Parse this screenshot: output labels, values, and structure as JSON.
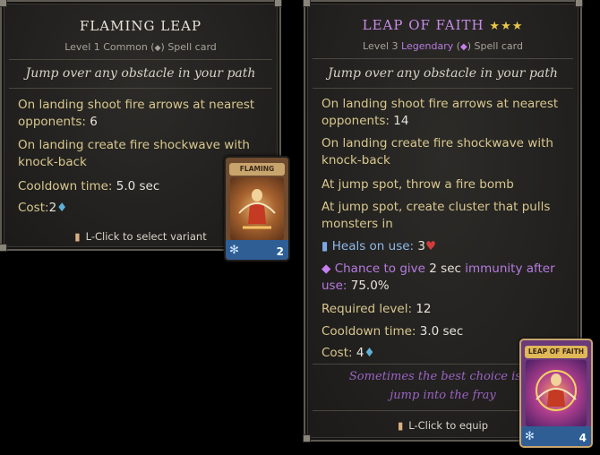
{
  "left_tooltip": {
    "title": "FLAMING LEAP",
    "level_text": "Level 1",
    "rarity": "Common",
    "rarity_icon": "gem-outline-icon",
    "card_type": "Spell card",
    "flavor": "Jump over any obstacle in your path",
    "lines": [
      {
        "label": "On landing shoot fire arrows at nearest opponents:",
        "value": "6"
      },
      {
        "label": "On landing create fire shockwave with knock-back",
        "value": ""
      },
      {
        "label": "Cooldown time:",
        "value": "5.0 sec"
      },
      {
        "label": "Cost:",
        "value": "2"
      }
    ],
    "footer": "L-Click to select variant",
    "card": {
      "banner": "FLAMING LEAP",
      "cost": "2"
    }
  },
  "right_tooltip": {
    "title": "LEAP OF FAITH",
    "stars": "★★★",
    "level_text": "Level 3",
    "rarity": "Legendary",
    "rarity_icon": "purple-gem-icon",
    "card_type": "Spell card",
    "flavor": "Jump over any obstacle in your path",
    "line1_label": "On landing shoot fire arrows at nearest opponents:",
    "line1_value": "14",
    "line2_label": "On landing create fire shockwave with knock-back",
    "line3_label": "At jump spot, throw a fire bomb",
    "line4_label": "At jump spot, create cluster that pulls monsters in",
    "heals_label": "Heals on use:",
    "heals_value": "3",
    "chance_label": "Chance to give",
    "chance_duration": "2 sec",
    "chance_effect": "immunity after use:",
    "chance_value": "75.0%",
    "required_label": "Required level:",
    "required_value": "12",
    "cooldown_label": "Cooldown time:",
    "cooldown_value": "3.0 sec",
    "cost_label": "Cost:",
    "cost_value": "4",
    "lore_line1": "Sometimes the best choice is to",
    "lore_line2": "jump into the fray",
    "footer": "L-Click to equip",
    "card": {
      "banner": "LEAP OF FAITH",
      "cost": "4"
    }
  },
  "colors": {
    "label_gold": "#d9c78e",
    "legendary_purple": "#b77be0",
    "mana_blue": "#5fb0d8"
  }
}
